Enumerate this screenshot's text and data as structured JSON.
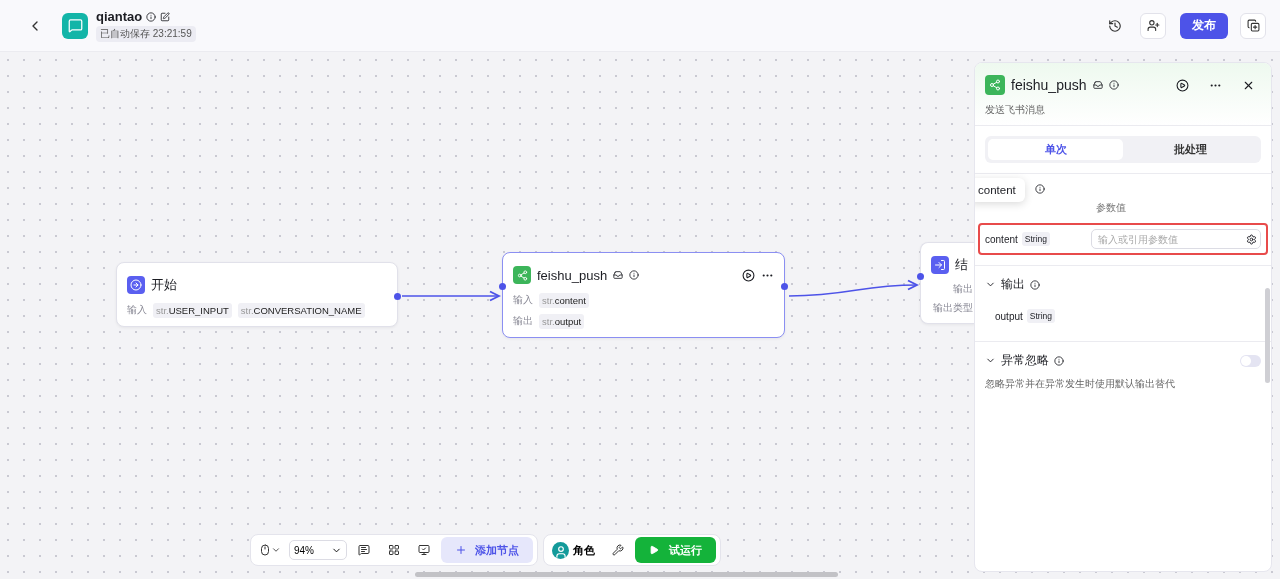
{
  "header": {
    "title": "qiantao",
    "autosave": "已自动保存 23:21:59",
    "publish": "发布"
  },
  "nodes": [
    {
      "kind": "start",
      "title": "开始",
      "selected": false,
      "rows": [
        {
          "label": "输入",
          "params": [
            {
              "prefix": "str.",
              "name": "USER_INPUT"
            },
            {
              "prefix": "str.",
              "name": "CONVERSATION_NAME"
            }
          ]
        }
      ]
    },
    {
      "kind": "plugin",
      "title": "feishu_push",
      "selected": true,
      "rows": [
        {
          "label": "输入",
          "params": [
            {
              "prefix": "str.",
              "name": "content"
            }
          ]
        },
        {
          "label": "输出",
          "params": [
            {
              "prefix": "str.",
              "name": "output"
            }
          ]
        }
      ]
    },
    {
      "kind": "end",
      "title": "结",
      "selected": false,
      "rows": [
        {
          "label": "输出",
          "params": []
        },
        {
          "label": "输出类型",
          "params": []
        }
      ]
    }
  ],
  "panel": {
    "title": "feishu_push",
    "description": "发送飞书消息",
    "tabs": [
      {
        "label": "单次",
        "selected": true
      },
      {
        "label": "批处理",
        "selected": false
      }
    ],
    "input": {
      "column": "参数值",
      "tooltip": "content",
      "params": [
        {
          "name": "content",
          "type": "String",
          "placeholder": "输入或引用参数值"
        }
      ]
    },
    "output": {
      "title": "输出",
      "params": [
        {
          "name": "output",
          "type": "String"
        }
      ]
    },
    "exception": {
      "title": "异常忽略",
      "on": false,
      "description": "忽略异常并在异常发生时使用默认输出替代"
    }
  },
  "toolbar": {
    "zoom": "94%",
    "add_node": "添加节点",
    "role": "角色",
    "run": "试运行"
  }
}
